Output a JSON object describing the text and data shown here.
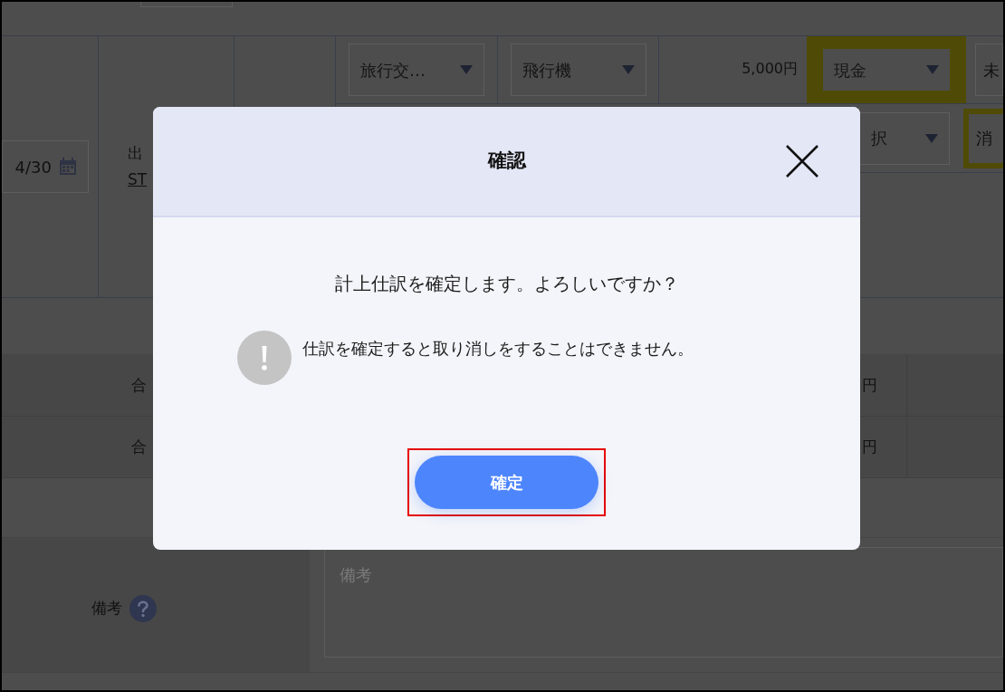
{
  "background": {
    "date": "4/30",
    "purpose_label": "出",
    "purpose_link": "ST",
    "selects_row_1": [
      {
        "text": "旅行交…",
        "highlighted": false
      },
      {
        "text": "飛行機",
        "highlighted": false
      }
    ],
    "amount": "5,000円",
    "payment": {
      "text": "現金",
      "highlighted": true
    },
    "column_5": "未",
    "select_row_2": {
      "text": "択",
      "highlighted": false
    },
    "column_6": {
      "text": "消",
      "highlighted": true
    },
    "totals": [
      {
        "label": "合",
        "value": "円"
      },
      {
        "label": "合",
        "value": "円"
      }
    ],
    "remarks": {
      "label": "備考",
      "placeholder": "備考"
    }
  },
  "dialog": {
    "title": "確認",
    "message": "計上仕訳を確定します。よろしいですか？",
    "warning": "仕訳を確定すると取り消しをすることはできません。",
    "confirm_button": "確定",
    "confirm_highlighted": true
  }
}
